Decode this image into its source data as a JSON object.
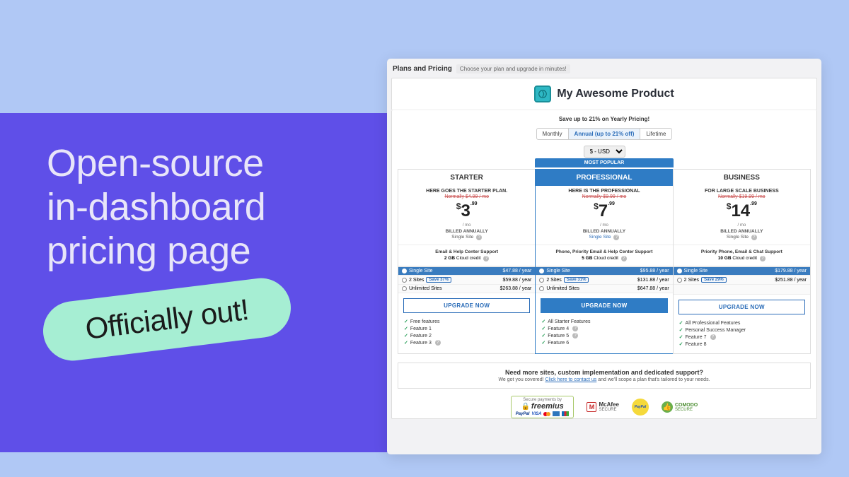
{
  "bg": {
    "headline_l1": "Open-source",
    "headline_l2": "in-dashboard",
    "headline_l3": "pricing page",
    "badge": "Officially out!"
  },
  "breadcrumb": {
    "title": "Plans and Pricing",
    "sub": "Choose your plan and upgrade in minutes!"
  },
  "product": "My Awesome Product",
  "save_header": "Save up to 21% on Yearly Pricing!",
  "billing": {
    "monthly": "Monthly",
    "annual": "Annual (up to 21% off)",
    "lifetime": "Lifetime"
  },
  "currency": "$ - USD",
  "popular_label": "MOST POPULAR",
  "plans": [
    {
      "name": "STARTER",
      "desc": "HERE GOES THE STARTER PLAN.",
      "strike": "Normally $4.99 / mo",
      "whole": "3",
      "cents": ".99",
      "per": "/ mo",
      "billed": "BILLED ANNUALLY",
      "site": "Single Site",
      "support": "Email & Help Center Support",
      "credit_amt": "2 GB",
      "credit_lbl": "Cloud credit",
      "tiers": [
        {
          "label": "Single Site",
          "price": "$47.88 / year",
          "selected": true
        },
        {
          "label": "2 Sites",
          "save": "Save 37%",
          "price": "$59.88 / year"
        },
        {
          "label": "Unlimited Sites",
          "price": "$263.88 / year"
        }
      ],
      "cta": "UPGRADE NOW",
      "features": [
        "Free features",
        "Feature 1",
        "Feature 2",
        "Feature 3"
      ],
      "feat_q": [
        false,
        false,
        false,
        true
      ]
    },
    {
      "name": "PROFESSIONAL",
      "popular": true,
      "desc": "HERE IS THE PROFESSIONAL",
      "strike": "Normally $9.99 / mo",
      "whole": "7",
      "cents": ".99",
      "per": "/ mo",
      "billed": "BILLED ANNUALLY",
      "site": "Single Site",
      "support": "Phone, Priority Email & Help Center Support",
      "credit_amt": "5 GB",
      "credit_lbl": "Cloud credit",
      "tiers": [
        {
          "label": "Single Site",
          "price": "$95.88 / year",
          "selected": true
        },
        {
          "label": "2 Sites",
          "save": "Save 31%",
          "price": "$131.88 / year"
        },
        {
          "label": "Unlimited Sites",
          "price": "$647.88 / year"
        }
      ],
      "cta": "UPGRADE NOW",
      "features": [
        "All Starter Features",
        "Feature 4",
        "Feature 5",
        "Feature 6"
      ],
      "feat_q": [
        false,
        true,
        true,
        false
      ]
    },
    {
      "name": "BUSINESS",
      "desc": "FOR LARGE SCALE BUSINESS",
      "strike": "Normally $19.99 / mo",
      "whole": "14",
      "cents": ".99",
      "per": "/ mo",
      "billed": "BILLED ANNUALLY",
      "site": "Single Site",
      "support": "Priority Phone, Email & Chat Support",
      "credit_amt": "10 GB",
      "credit_lbl": "Cloud credit",
      "tiers": [
        {
          "label": "Single Site",
          "price": "$179.88 / year",
          "selected": true
        },
        {
          "label": "2 Sites",
          "save": "Save 29%",
          "price": "$251.88 / year"
        },
        {
          "label": "",
          "price": ""
        }
      ],
      "cta": "UPGRADE NOW",
      "features": [
        "All Professional Features",
        "Personal Success Manager",
        "Feature 7",
        "Feature 8"
      ],
      "feat_q": [
        false,
        false,
        true,
        false
      ]
    }
  ],
  "more": {
    "heading": "Need more sites, custom implementation and dedicated support?",
    "pre": "We got you covered! ",
    "link": "Click here to contact us",
    "post": " and we'll scope a plan that's tailored to your needs."
  },
  "secure": {
    "by": "Secure payments by",
    "freemius": "freemius",
    "paypal": "PayPal",
    "visa": "VISA",
    "mcafee": "McAfee",
    "mcafee2": "SECURE",
    "comodo": "COMODO",
    "comodo2": "SECURE"
  }
}
